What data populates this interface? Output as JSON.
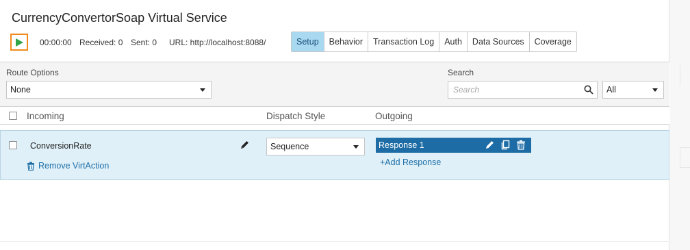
{
  "service": {
    "title": "CurrencyConvertorSoap Virtual Service"
  },
  "status": {
    "timer": "00:00:00",
    "received": "Received: 0",
    "sent": "Sent: 0",
    "url": "URL: http://localhost:8088/"
  },
  "tabs": [
    {
      "label": "Setup",
      "active": true
    },
    {
      "label": "Behavior",
      "active": false
    },
    {
      "label": "Transaction Log",
      "active": false
    },
    {
      "label": "Auth",
      "active": false
    },
    {
      "label": "Data Sources",
      "active": false
    },
    {
      "label": "Coverage",
      "active": false
    }
  ],
  "filters": {
    "route_label": "Route Options",
    "route_value": "None",
    "search_label": "Search",
    "search_placeholder": "Search",
    "scope_value": "All"
  },
  "columns": {
    "incoming": "Incoming",
    "dispatch": "Dispatch Style",
    "outgoing": "Outgoing"
  },
  "rows": [
    {
      "name": "ConversionRate",
      "remove_label": "Remove VirtAction",
      "dispatch": "Sequence",
      "response": "Response 1",
      "add_response": "+Add Response"
    }
  ],
  "colors": {
    "accent": "#1d6ca5",
    "active_tab": "#a9d8f1",
    "play_border": "#f08a1d",
    "play_fill": "#2fa34a",
    "row_bg": "#dff0f8"
  },
  "icons": [
    "play-icon",
    "search-icon",
    "pencil-icon",
    "copy-icon",
    "trash-icon",
    "chevron-down-icon"
  ]
}
